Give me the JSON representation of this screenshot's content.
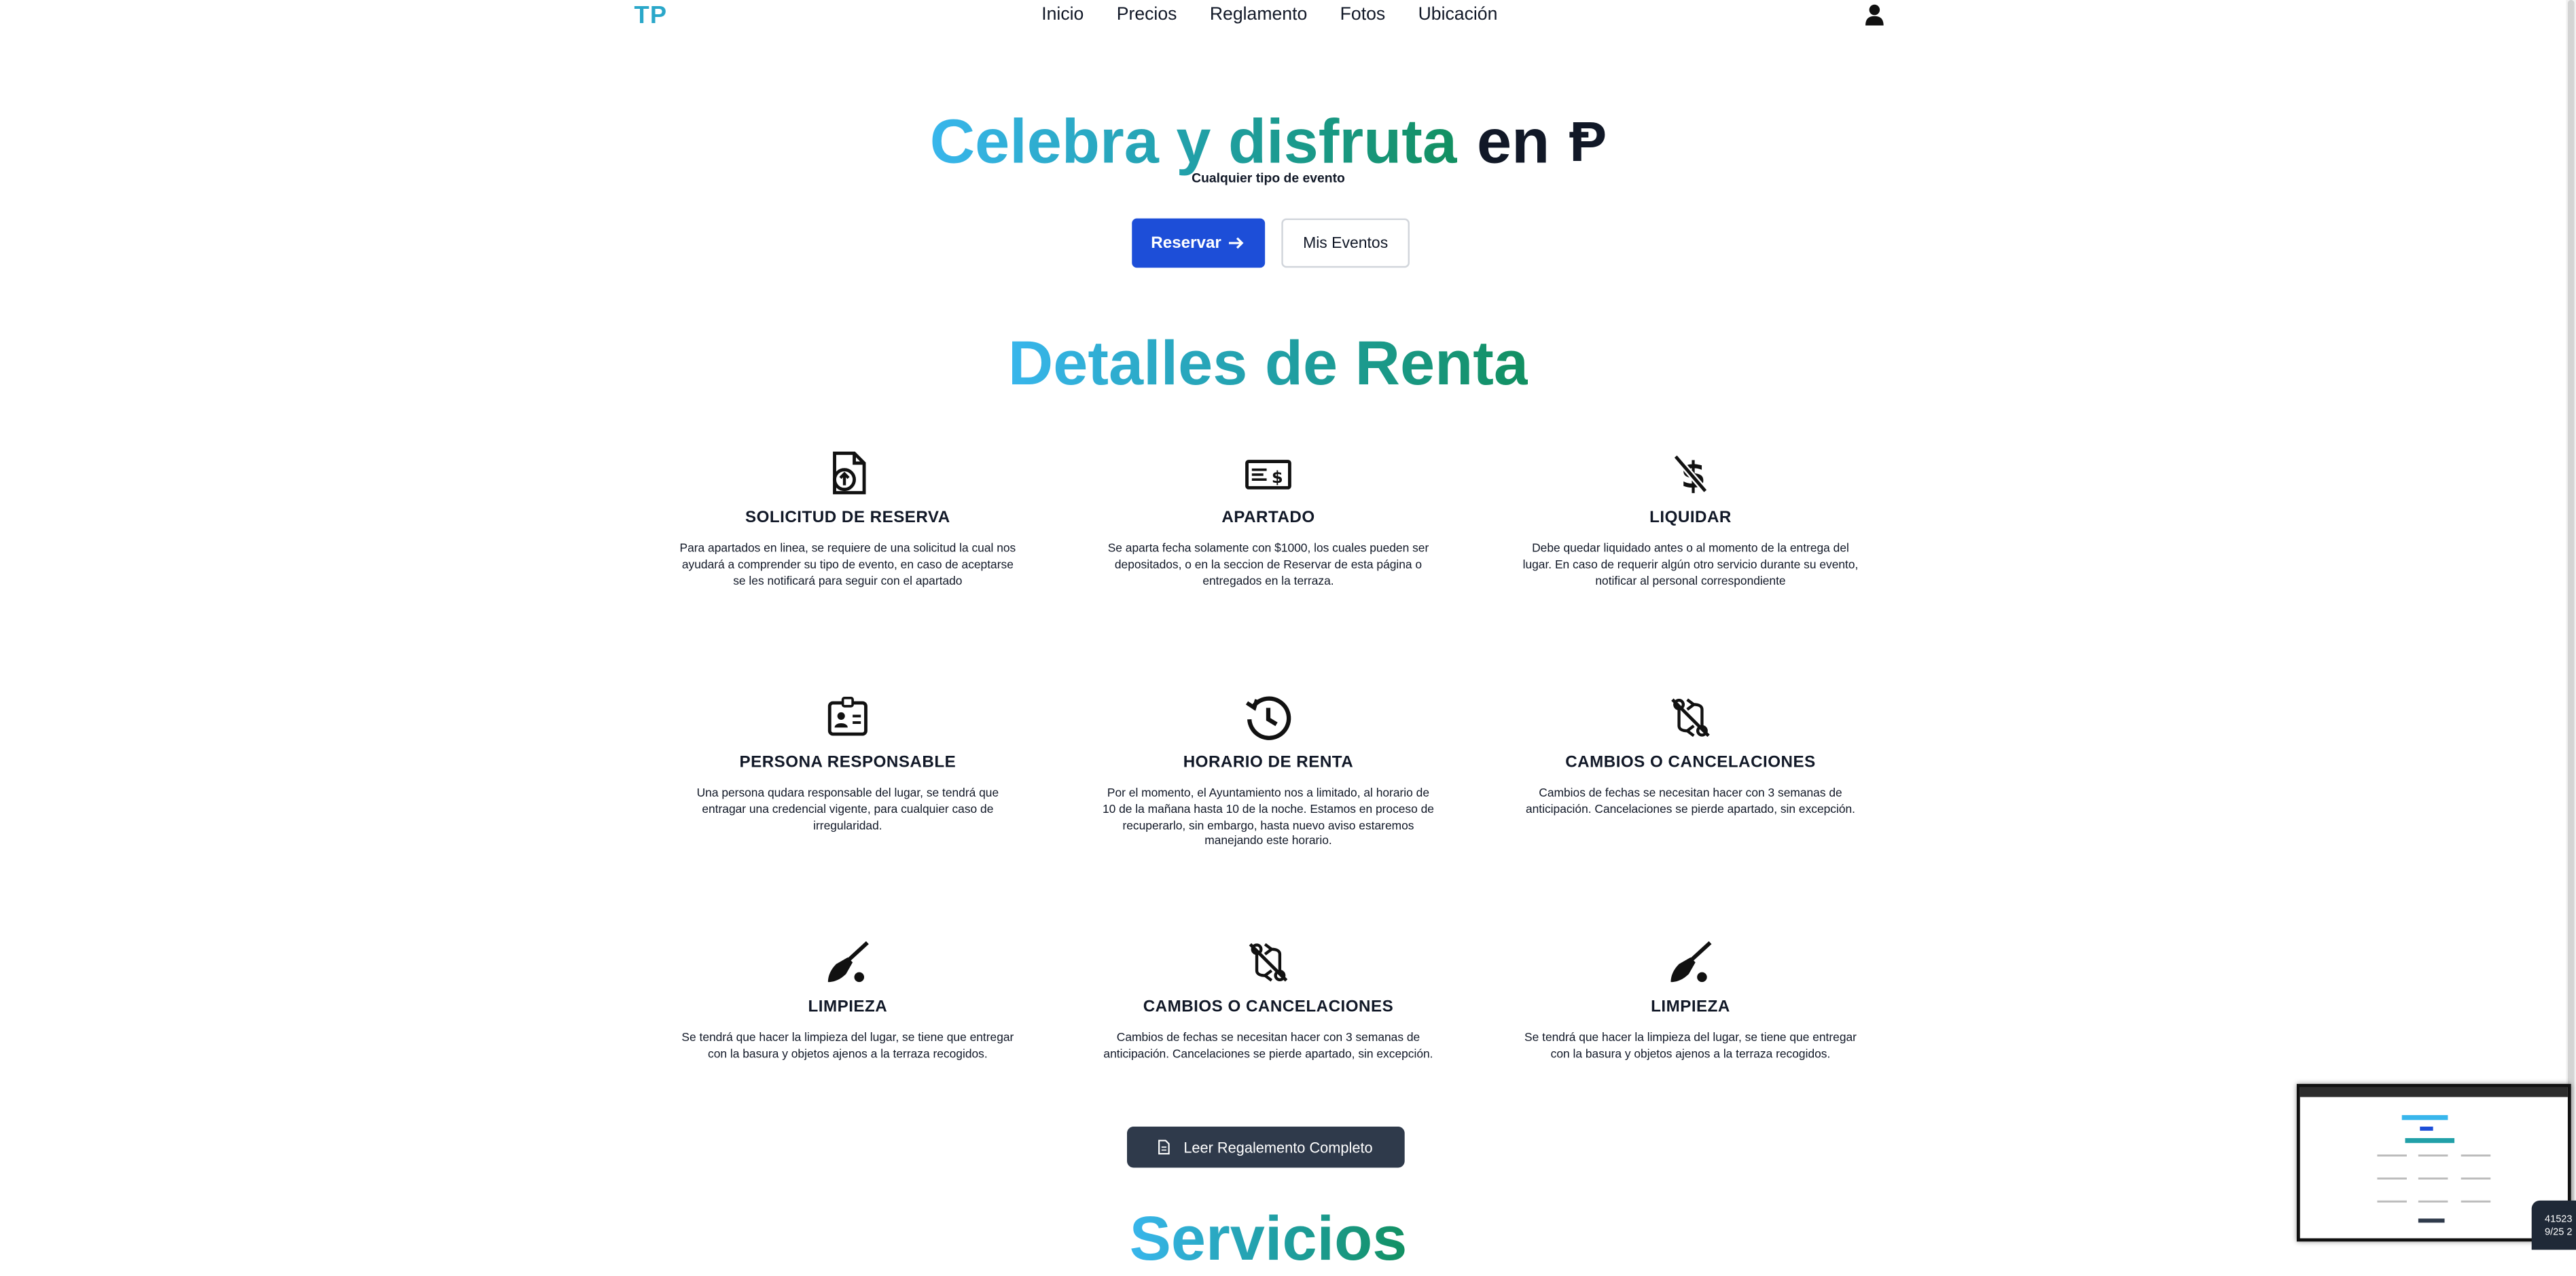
{
  "nav": {
    "logo": "TP",
    "items": [
      {
        "label": "Inicio"
      },
      {
        "label": "Precios"
      },
      {
        "label": "Reglamento"
      },
      {
        "label": "Fotos"
      },
      {
        "label": "Ubicación"
      }
    ],
    "user_icon": "user-icon"
  },
  "hero": {
    "title_gradient": "Celebra y disfruta",
    "title_en": "en",
    "logo_glyph": "Ᵽ",
    "subtitle": "Cualquier tipo de evento",
    "reserve_label": "Reservar",
    "my_events_label": "Mis Eventos"
  },
  "details": {
    "title": "Detalles de Renta",
    "cards": [
      {
        "icon": "file-upload-icon",
        "title": "SOLICITUD DE RESERVA",
        "desc": "Para apartados en linea, se requiere de una solicitud la cual nos ayudará a comprender su tipo de evento, en caso de aceptarse se les notificará para seguir con el apartado"
      },
      {
        "icon": "money-check-icon",
        "title": "APARTADO",
        "desc": "Se aparta fecha solamente con $1000, los cuales pueden ser depositados, o en la seccion de Reservar de esta página o entregados en la terraza."
      },
      {
        "icon": "dollar-off-icon",
        "title": "LIQUIDAR",
        "desc": "Debe quedar liquidado antes o al momento de la entrega del lugar. En caso de requerir algún otro servicio durante su evento, notificar al personal correspondiente"
      },
      {
        "icon": "id-badge-icon",
        "title": "PERSONA RESPONSABLE",
        "desc": "Una persona qudara responsable del lugar, se tendrá que entragar una credencial vigente, para cualquier caso de irregularidad."
      },
      {
        "icon": "history-clock-icon",
        "title": "HORARIO DE RENTA",
        "desc": "Por el momento, el Ayuntamiento nos a limitado, al horario de 10 de la mañana hasta 10 de la noche. Estamos en proceso de recuperarlo, sin embargo, hasta nuevo aviso estaremos manejando este horario."
      },
      {
        "icon": "git-compare-off-icon",
        "title": "CAMBIOS O CANCELACIONES",
        "desc": "Cambios de fechas se necesitan hacer con 3 semanas de anticipación. Cancelaciones se pierde apartado, sin excepción."
      },
      {
        "icon": "broom-icon",
        "title": "LIMPIEZA",
        "desc": "Se tendrá que hacer la limpieza del lugar, se tiene que entregar con la basura y objetos ajenos a la terraza recogidos."
      },
      {
        "icon": "git-compare-off-icon",
        "title": "CAMBIOS O CANCELACIONES",
        "desc": "Cambios de fechas se necesitan hacer con 3 semanas de anticipación. Cancelaciones se pierde apartado, sin excepción."
      },
      {
        "icon": "broom-icon",
        "title": "LIMPIEZA",
        "desc": "Se tendrá que hacer la limpieza del lugar, se tiene que entregar con la basura y objetos ajenos a la terraza recogidos."
      }
    ],
    "read_button": "Leer Regalemento Completo"
  },
  "services": {
    "title": "Servicios"
  },
  "corner": {
    "line1": "41523",
    "line2": "9/25 2"
  },
  "colors": {
    "primary": "#1d4ed8",
    "gradient_start": "#38b6ec",
    "gradient_end": "#129061",
    "dark_button": "#2f3a4b"
  }
}
